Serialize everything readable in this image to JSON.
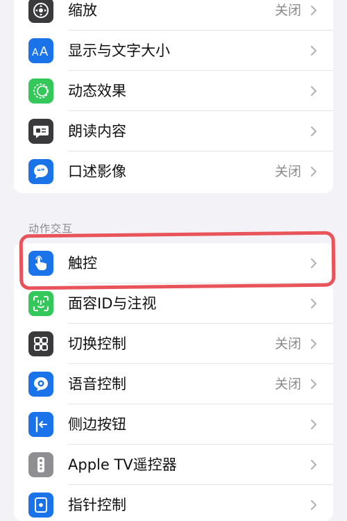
{
  "group1": {
    "rows": [
      {
        "label": "缩放",
        "value": "关闭",
        "icon": "zoom-icon",
        "color": "#3a3a3c"
      },
      {
        "label": "显示与文字大小",
        "value": "",
        "icon": "text-size-icon",
        "color": "#1a73e8"
      },
      {
        "label": "动态效果",
        "value": "",
        "icon": "motion-icon",
        "color": "#34c759"
      },
      {
        "label": "朗读内容",
        "value": "",
        "icon": "speech-icon",
        "color": "#3a3a3c"
      },
      {
        "label": "口述影像",
        "value": "关闭",
        "icon": "audio-description-icon",
        "color": "#1a73e8"
      }
    ]
  },
  "section_header": "动作交互",
  "group2": {
    "rows": [
      {
        "label": "触控",
        "value": "",
        "icon": "touch-icon",
        "color": "#1a73e8"
      },
      {
        "label": "面容ID与注视",
        "value": "",
        "icon": "face-id-icon",
        "color": "#34c759"
      },
      {
        "label": "切换控制",
        "value": "关闭",
        "icon": "switch-control-icon",
        "color": "#3a3a3c"
      },
      {
        "label": "语音控制",
        "value": "关闭",
        "icon": "voice-control-icon",
        "color": "#1a73e8"
      },
      {
        "label": "侧边按钮",
        "value": "",
        "icon": "side-button-icon",
        "color": "#1a73e8"
      },
      {
        "label": "Apple TV遥控器",
        "value": "",
        "icon": "apple-tv-remote-icon",
        "color": "#8e8e93"
      },
      {
        "label": "指针控制",
        "value": "",
        "icon": "pointer-control-icon",
        "color": "#1a73e8"
      }
    ]
  },
  "highlight_color": "#e8545a"
}
